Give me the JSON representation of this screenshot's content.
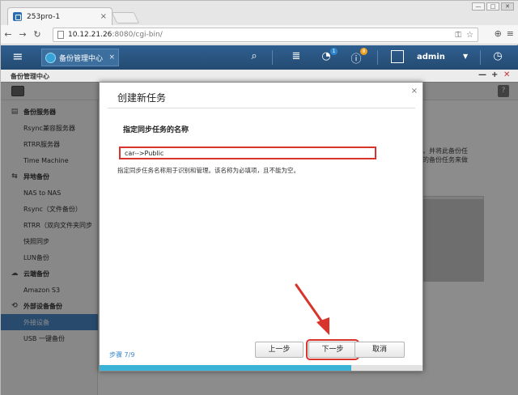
{
  "browser": {
    "tab_title": "253pro-1",
    "tab_close": "×",
    "url_host": "10.12.21.26",
    "url_path": ":8080/cgi-bin/",
    "win_min": "—",
    "win_max": "□",
    "win_close": "✕"
  },
  "app_header": {
    "app_tab_label": "备份管理中心",
    "app_tab_close": "×",
    "notification_count": "1",
    "alert_count": "8",
    "username": "admin",
    "colors": {
      "header": "#2f5f8f",
      "badge_blue": "#2f86d0",
      "badge_orange": "#f0a020"
    }
  },
  "app_window": {
    "title": "备份管理中心",
    "ctl_min": "—",
    "ctl_add": "+",
    "ctl_close": "✕",
    "help": "?"
  },
  "sidebar": {
    "groups": [
      {
        "label": "备份服务器",
        "icon": "server-icon",
        "items": [
          "Rsync兼容服务器",
          "RTRR服务器",
          "Time Machine"
        ]
      },
      {
        "label": "异地备份",
        "icon": "remote-backup-icon",
        "items": [
          "NAS to NAS",
          "Rsync（文件备份）",
          "RTRR（双向文件夹同步",
          "快照同步",
          "LUN备份"
        ]
      },
      {
        "label": "云端备份",
        "icon": "cloud-icon",
        "items": [
          "Amazon S3"
        ]
      },
      {
        "label": "外部设备备份",
        "icon": "sync-icon",
        "items": [
          "外接设备",
          "USB 一键备份"
        ]
      }
    ],
    "active_item": "外接设备"
  },
  "background_text": {
    "line1": "多，并将此备份任",
    "line2": "本的备份任务来做"
  },
  "modal": {
    "title": "创建新任务",
    "close": "×",
    "section_heading": "指定同步任务的名称",
    "task_name_value": "car-->Public",
    "hint": "指定同步任务名称用于识别和管理。该名称为必填项，且不能为空。",
    "step_label": "步骤 7/9",
    "buttons": {
      "prev": "上一步",
      "next": "下一步",
      "cancel": "取消"
    },
    "progress": 0.78,
    "colors": {
      "highlight": "#d8342b",
      "progress": "#3bb3d6"
    }
  }
}
